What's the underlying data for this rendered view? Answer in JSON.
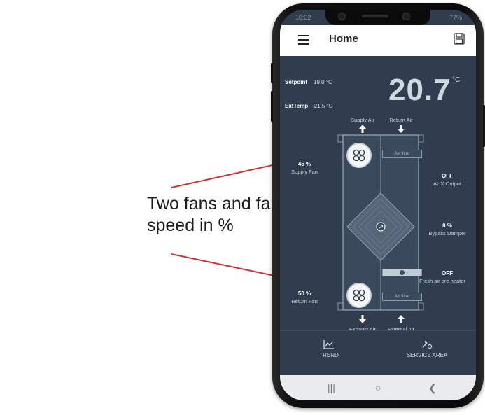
{
  "annotation": {
    "text": "Two fans and fan speed in %",
    "arrow_color": "#d32f2f"
  },
  "status_bar": {
    "time": "10:32",
    "battery": "77%"
  },
  "app_bar": {
    "title": "Home",
    "menu_icon": "hamburger-menu-icon",
    "save_icon": "floppy-disk-icon"
  },
  "readings": {
    "setpoint_label": "Setpoint",
    "setpoint_value": "19.0 °C",
    "exttemp_label": "ExtTemp",
    "exttemp_value": "-21.5 °C",
    "current_temp": "20.7",
    "current_temp_unit": "°C"
  },
  "unit_diagram": {
    "supply_air_label": "Supply Air",
    "return_air_label": "Return Air",
    "exhaust_air_label": "Exhaust Air",
    "external_air_label": "External Air",
    "air_filter_top": "Air filter",
    "air_filter_bottom": "Air filter",
    "supply_fan_value": "45 %",
    "supply_fan_label": "Supply Fan",
    "return_fan_value": "50 %",
    "return_fan_label": "Return Fan",
    "aux_output_value": "OFF",
    "aux_output_label": "AUX Output",
    "bypass_value": "0 %",
    "bypass_label": "Bypass Damper",
    "preheater_value": "OFF",
    "preheater_label": "Fresh air pre heater"
  },
  "bottom_tabs": {
    "trend_label": "TREND",
    "service_label": "SERVICE AREA"
  },
  "colors": {
    "background": "#2f3d4e",
    "app_bar": "#ffffff"
  }
}
